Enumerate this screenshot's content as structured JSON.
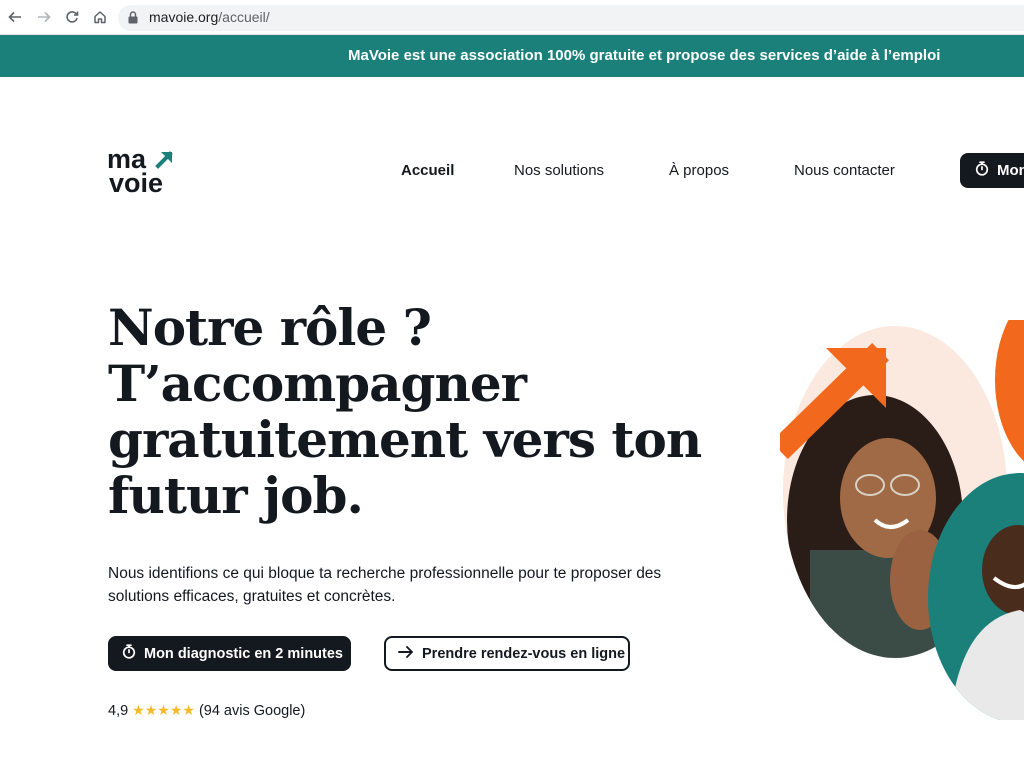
{
  "browser": {
    "url_domain": "mavoie.org",
    "url_path": "/accueil/",
    "icons": [
      "back-arrow-icon",
      "forward-arrow-icon",
      "reload-icon",
      "home-icon",
      "lock-icon"
    ]
  },
  "banner": {
    "text": "MaVoie est une association 100% gratuite et propose des services d’aide à l’emploi"
  },
  "header": {
    "logo_top": "ma",
    "logo_bottom": "voie",
    "nav": [
      "Accueil",
      "Nos solutions",
      "À propos",
      "Nous contacter"
    ],
    "cta_label": "Mon"
  },
  "hero": {
    "title_lines": [
      "Notre rôle ?",
      "T’accompagner",
      "gratuitement vers ton",
      "futur job."
    ],
    "description": "Nous identifions ce qui bloque ta recherche professionnelle pour te proposer des solutions efficaces, gratuites et concrètes.",
    "primary_cta": "Mon diagnostic en 2 minutes",
    "secondary_cta": "Prendre rendez-vous en ligne",
    "rating_value": "4,9",
    "rating_stars": 5,
    "rating_count": "(94 avis Google)"
  },
  "colors": {
    "brand_teal": "#1b7f7a",
    "brand_orange": "#f2681c",
    "ink": "#14181f",
    "star": "#f7b928",
    "blush": "#fbe8df"
  }
}
